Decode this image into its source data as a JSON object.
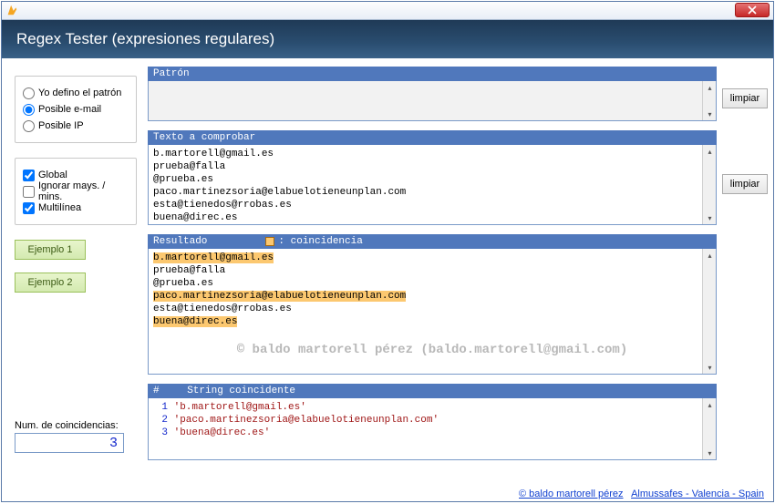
{
  "window": {
    "title": "Regex Tester (expresiones regulares)"
  },
  "radios": {
    "define": "Yo defino el patrón",
    "email": "Posible e-mail",
    "ip": "Posible IP",
    "selected": "email"
  },
  "checks": {
    "global": "Global",
    "ignorecase": "Ignorar mays. / mins.",
    "multiline": "Multilínea"
  },
  "buttons": {
    "example1": "Ejemplo 1",
    "example2": "Ejemplo 2",
    "clear": "limpiar"
  },
  "labels": {
    "pattern": "Patrón",
    "test": "Texto a comprobar",
    "result": "Resultado",
    "match_legend": ": coincidencia",
    "table_header_idx": "#",
    "table_header_str": "String coincidente",
    "count_label": "Num. de coincidencias:"
  },
  "pattern_value": "",
  "test_lines": [
    "b.martorell@gmail.es",
    "prueba@falla",
    "@prueba.es",
    "paco.martinezsoria@elabuelotieneunplan.com",
    "esta@tienedos@rrobas.es",
    "buena@direc.es"
  ],
  "result_lines": [
    {
      "text": "b.martorell@gmail.es",
      "match": true
    },
    {
      "text": "prueba@falla",
      "match": false
    },
    {
      "text": "@prueba.es",
      "match": false
    },
    {
      "text": "paco.martinezsoria@elabuelotieneunplan.com",
      "match": true
    },
    {
      "text": "esta@tienedos@rrobas.es",
      "match": false
    },
    {
      "text": "buena@direc.es",
      "match": true
    }
  ],
  "matches": [
    {
      "i": 1,
      "s": "'b.martorell@gmail.es'"
    },
    {
      "i": 2,
      "s": "'paco.martinezsoria@elabuelotieneunplan.com'"
    },
    {
      "i": 3,
      "s": "'buena@direc.es'"
    }
  ],
  "match_count": "3",
  "watermark": "© baldo martorell pérez (baldo.martorell@gmail.com)",
  "footer": {
    "copy": "© baldo martorell pérez",
    "loc": "Almussafes - Valencia - Spain"
  }
}
